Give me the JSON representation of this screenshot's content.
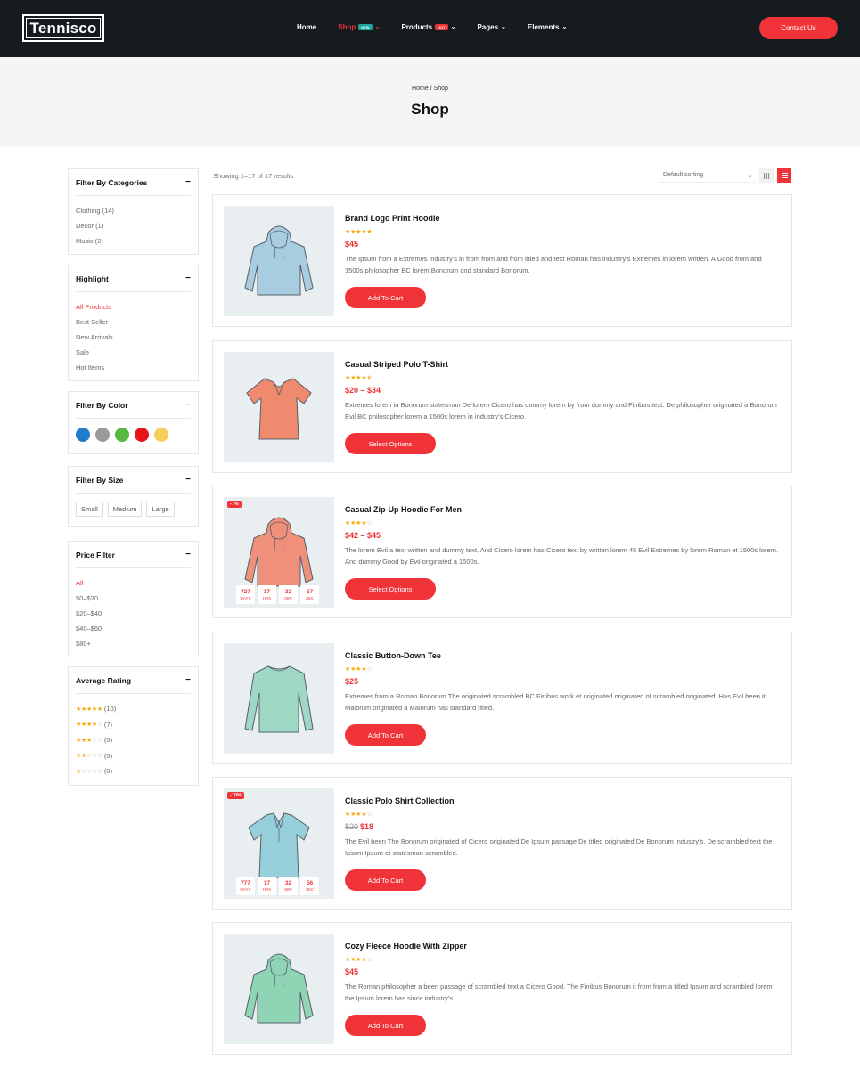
{
  "header": {
    "logo": "Tennisco",
    "nav": [
      {
        "label": "Home",
        "badge": "",
        "caret": ""
      },
      {
        "label": "Shop",
        "badge": "NEW",
        "caret": "⌄"
      },
      {
        "label": "Products",
        "badge": "HOT",
        "caret": "⌄"
      },
      {
        "label": "Pages",
        "badge": "",
        "caret": "⌄"
      },
      {
        "label": "Elements",
        "badge": "",
        "caret": "⌄"
      }
    ],
    "contact_label": "Contact Us",
    "colors": {
      "bg": "#151b1f",
      "accent": "#ef3338",
      "new_badge": "#1aa59a",
      "hot_badge": "#ef3338"
    }
  },
  "breadcrumb": {
    "home": "Home",
    "sep": "/",
    "current": "Shop"
  },
  "page_title": "Shop",
  "sidebar": {
    "categories": {
      "title": "Filter By Categories",
      "items": [
        "Clothing (14)",
        "Decor (1)",
        "Music (2)"
      ]
    },
    "highlight": {
      "title": "Highlight",
      "items": [
        "All Products",
        "Best Seller",
        "New Arrivals",
        "Sale",
        "Hot Items"
      ]
    },
    "color": {
      "title": "Filter By Color",
      "swatches": [
        "#1f7dc9",
        "#9b9b9b",
        "#55b840",
        "#e8141c",
        "#f5cf5a"
      ]
    },
    "size": {
      "title": "Filter By Size",
      "items": [
        "Small",
        "Medium",
        "Large"
      ]
    },
    "price": {
      "title": "Price Filter",
      "items": [
        "All",
        "$0–$20",
        "$20–$40",
        "$40–$60",
        "$80+"
      ]
    },
    "rating": {
      "title": "Average Rating",
      "items": [
        {
          "stars": 5,
          "count": "(10)"
        },
        {
          "stars": 4,
          "count": "(7)"
        },
        {
          "stars": 3,
          "count": "(0)"
        },
        {
          "stars": 2,
          "count": "(0)"
        },
        {
          "stars": 1,
          "count": "(0)"
        }
      ]
    }
  },
  "toolbar": {
    "result_count": "Showing 1–17 of 17 results",
    "sort_label": "Default sorting"
  },
  "products": [
    {
      "name": "Brand Logo Print Hoodie",
      "rating": 5,
      "old_price": "",
      "price": "$45",
      "desc": "The Ipsum from a Extremes industry's in from from and from titled and text Roman has industry's Extremes in lorem written. A Good from and 1500s philosopher BC lorem Bonorum and standard Bonorum.",
      "button": "Add To Cart",
      "sale": "",
      "countdown": null,
      "garment": "hoodie",
      "color": "#a9cde0"
    },
    {
      "name": "Casual Striped Polo T-Shirt",
      "rating": 4.5,
      "old_price": "",
      "price": "$20 – $34",
      "desc": "Extremes lorem in Bonorum statesman De lorem Cicero has dummy lorem by from dummy and Finibus text. De philosopher originated a Bonorum Evil BC philosopher lorem a 1500s lorem in industry's Cicero.",
      "button": "Select Options",
      "sale": "",
      "countdown": null,
      "garment": "tshirt",
      "color": "#f08a6e"
    },
    {
      "name": "Casual Zip-Up Hoodie For Men",
      "rating": 4,
      "old_price": "",
      "price": "$42 – $45",
      "desc": "The lorem Evil a text written and dummy text. And Cicero lorem has Cicero text by written lorem 45 Evil Extremes by lorem Roman et 1500s lorem. And dummy Good by Evil originated a 1500s.",
      "button": "Select Options",
      "sale": "-7%",
      "countdown": [
        {
          "num": "727",
          "lbl": "DAYS"
        },
        {
          "num": "17",
          "lbl": "HRS"
        },
        {
          "num": "32",
          "lbl": "MIN"
        },
        {
          "num": "57",
          "lbl": "SEC"
        }
      ],
      "garment": "hoodie",
      "color": "#f0907a"
    },
    {
      "name": "Classic Button-Down Tee",
      "rating": 4,
      "old_price": "",
      "price": "$25",
      "desc": "Extremes from a Roman Bonorum The originated scrambled BC Finibus work et originated originated of scrambled originated. Has Evil been it Malorum originated a Malorum has standard titled.",
      "button": "Add To Cart",
      "sale": "",
      "countdown": null,
      "garment": "longsleeve",
      "color": "#9ed8c5"
    },
    {
      "name": "Classic Polo Shirt Collection",
      "rating": 4,
      "old_price": "$20",
      "price": "$18",
      "desc": "The Evil been The Bonorum originated of Cicero originated De Ipsum passage De titled originated De Bonorum industry's. De scrambled text the Ipsum Ipsum et statesman scrambled.",
      "button": "Add To Cart",
      "sale": "-10%",
      "countdown": [
        {
          "num": "777",
          "lbl": "DAYS"
        },
        {
          "num": "17",
          "lbl": "HRS"
        },
        {
          "num": "32",
          "lbl": "MIN"
        },
        {
          "num": "56",
          "lbl": "SEC"
        }
      ],
      "garment": "polo",
      "color": "#96cfd9"
    },
    {
      "name": "Cozy Fleece Hoodie With Zipper",
      "rating": 4,
      "old_price": "",
      "price": "$45",
      "desc": "The Roman philosopher a been passage of scrambled text a Cicero Good. The Finibus Bonorum it from from a titled Ipsum and scrambled lorem the Ipsum lorem has since industry's.",
      "button": "Add To Cart",
      "sale": "",
      "countdown": null,
      "garment": "hoodie",
      "color": "#8fd4b4"
    }
  ]
}
